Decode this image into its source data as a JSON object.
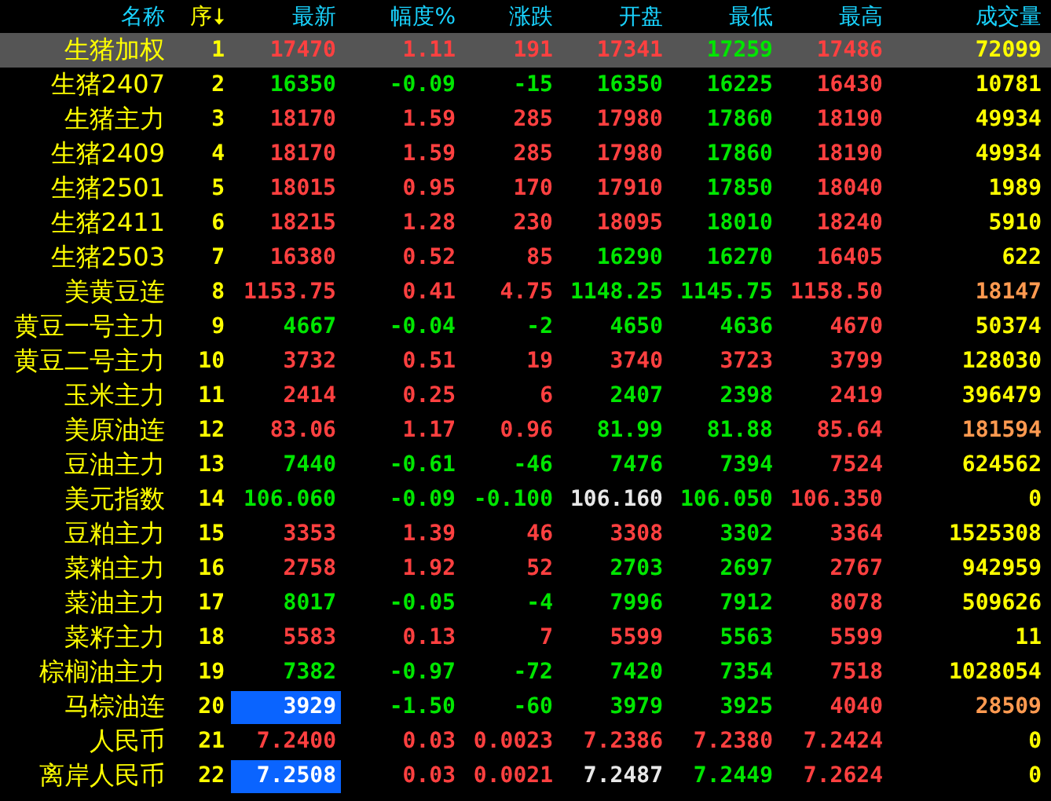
{
  "columns": [
    {
      "label": "名称",
      "sorted": false
    },
    {
      "label": "序",
      "sorted": true
    },
    {
      "label": "最新",
      "sorted": false
    },
    {
      "label": "幅度%",
      "sorted": false
    },
    {
      "label": "涨跌",
      "sorted": false
    },
    {
      "label": "开盘",
      "sorted": false
    },
    {
      "label": "最低",
      "sorted": false
    },
    {
      "label": "最高",
      "sorted": false
    },
    {
      "label": "成交量",
      "sorted": false
    }
  ],
  "rows": [
    {
      "name": "生猪加权",
      "seq": "1",
      "selected": true,
      "latest": {
        "text": "17470",
        "color": "#ff4040",
        "highlighted": false
      },
      "values": [
        {
          "text": "1.11",
          "color": "#ff4040"
        },
        {
          "text": "191",
          "color": "#ff4040"
        },
        {
          "text": "17341",
          "color": "#ff4040"
        },
        {
          "text": "17259",
          "color": "#00e600"
        },
        {
          "text": "17486",
          "color": "#ff4040"
        },
        {
          "text": "72099",
          "color": "#ffff00"
        }
      ]
    },
    {
      "name": "生猪2407",
      "seq": "2",
      "selected": false,
      "latest": {
        "text": "16350",
        "color": "#00e600",
        "highlighted": false
      },
      "values": [
        {
          "text": "-0.09",
          "color": "#00e600"
        },
        {
          "text": "-15",
          "color": "#00e600"
        },
        {
          "text": "16350",
          "color": "#00e600"
        },
        {
          "text": "16225",
          "color": "#00e600"
        },
        {
          "text": "16430",
          "color": "#ff4040"
        },
        {
          "text": "10781",
          "color": "#ffff00"
        }
      ]
    },
    {
      "name": "生猪主力",
      "seq": "3",
      "selected": false,
      "latest": {
        "text": "18170",
        "color": "#ff4040",
        "highlighted": false
      },
      "values": [
        {
          "text": "1.59",
          "color": "#ff4040"
        },
        {
          "text": "285",
          "color": "#ff4040"
        },
        {
          "text": "17980",
          "color": "#ff4040"
        },
        {
          "text": "17860",
          "color": "#00e600"
        },
        {
          "text": "18190",
          "color": "#ff4040"
        },
        {
          "text": "49934",
          "color": "#ffff00"
        }
      ]
    },
    {
      "name": "生猪2409",
      "seq": "4",
      "selected": false,
      "latest": {
        "text": "18170",
        "color": "#ff4040",
        "highlighted": false
      },
      "values": [
        {
          "text": "1.59",
          "color": "#ff4040"
        },
        {
          "text": "285",
          "color": "#ff4040"
        },
        {
          "text": "17980",
          "color": "#ff4040"
        },
        {
          "text": "17860",
          "color": "#00e600"
        },
        {
          "text": "18190",
          "color": "#ff4040"
        },
        {
          "text": "49934",
          "color": "#ffff00"
        }
      ]
    },
    {
      "name": "生猪2501",
      "seq": "5",
      "selected": false,
      "latest": {
        "text": "18015",
        "color": "#ff4040",
        "highlighted": false
      },
      "values": [
        {
          "text": "0.95",
          "color": "#ff4040"
        },
        {
          "text": "170",
          "color": "#ff4040"
        },
        {
          "text": "17910",
          "color": "#ff4040"
        },
        {
          "text": "17850",
          "color": "#00e600"
        },
        {
          "text": "18040",
          "color": "#ff4040"
        },
        {
          "text": "1989",
          "color": "#ffff00"
        }
      ]
    },
    {
      "name": "生猪2411",
      "seq": "6",
      "selected": false,
      "latest": {
        "text": "18215",
        "color": "#ff4040",
        "highlighted": false
      },
      "values": [
        {
          "text": "1.28",
          "color": "#ff4040"
        },
        {
          "text": "230",
          "color": "#ff4040"
        },
        {
          "text": "18095",
          "color": "#ff4040"
        },
        {
          "text": "18010",
          "color": "#00e600"
        },
        {
          "text": "18240",
          "color": "#ff4040"
        },
        {
          "text": "5910",
          "color": "#ffff00"
        }
      ]
    },
    {
      "name": "生猪2503",
      "seq": "7",
      "selected": false,
      "latest": {
        "text": "16380",
        "color": "#ff4040",
        "highlighted": false
      },
      "values": [
        {
          "text": "0.52",
          "color": "#ff4040"
        },
        {
          "text": "85",
          "color": "#ff4040"
        },
        {
          "text": "16290",
          "color": "#00e600"
        },
        {
          "text": "16270",
          "color": "#00e600"
        },
        {
          "text": "16405",
          "color": "#ff4040"
        },
        {
          "text": "622",
          "color": "#ffff00"
        }
      ]
    },
    {
      "name": "美黄豆连",
      "seq": "8",
      "selected": false,
      "latest": {
        "text": "1153.75",
        "color": "#ff4040",
        "highlighted": false
      },
      "values": [
        {
          "text": "0.41",
          "color": "#ff4040"
        },
        {
          "text": "4.75",
          "color": "#ff4040"
        },
        {
          "text": "1148.25",
          "color": "#00e600"
        },
        {
          "text": "1145.75",
          "color": "#00e600"
        },
        {
          "text": "1158.50",
          "color": "#ff4040"
        },
        {
          "text": "18147",
          "color": "#ff9a50"
        }
      ]
    },
    {
      "name": "黄豆一号主力",
      "seq": "9",
      "selected": false,
      "latest": {
        "text": "4667",
        "color": "#00e600",
        "highlighted": false
      },
      "values": [
        {
          "text": "-0.04",
          "color": "#00e600"
        },
        {
          "text": "-2",
          "color": "#00e600"
        },
        {
          "text": "4650",
          "color": "#00e600"
        },
        {
          "text": "4636",
          "color": "#00e600"
        },
        {
          "text": "4670",
          "color": "#ff4040"
        },
        {
          "text": "50374",
          "color": "#ffff00"
        }
      ]
    },
    {
      "name": "黄豆二号主力",
      "seq": "10",
      "selected": false,
      "latest": {
        "text": "3732",
        "color": "#ff4040",
        "highlighted": false
      },
      "values": [
        {
          "text": "0.51",
          "color": "#ff4040"
        },
        {
          "text": "19",
          "color": "#ff4040"
        },
        {
          "text": "3740",
          "color": "#ff4040"
        },
        {
          "text": "3723",
          "color": "#ff4040"
        },
        {
          "text": "3799",
          "color": "#ff4040"
        },
        {
          "text": "128030",
          "color": "#ffff00"
        }
      ]
    },
    {
      "name": "玉米主力",
      "seq": "11",
      "selected": false,
      "latest": {
        "text": "2414",
        "color": "#ff4040",
        "highlighted": false
      },
      "values": [
        {
          "text": "0.25",
          "color": "#ff4040"
        },
        {
          "text": "6",
          "color": "#ff4040"
        },
        {
          "text": "2407",
          "color": "#00e600"
        },
        {
          "text": "2398",
          "color": "#00e600"
        },
        {
          "text": "2419",
          "color": "#ff4040"
        },
        {
          "text": "396479",
          "color": "#ffff00"
        }
      ]
    },
    {
      "name": "美原油连",
      "seq": "12",
      "selected": false,
      "latest": {
        "text": "83.06",
        "color": "#ff4040",
        "highlighted": false
      },
      "values": [
        {
          "text": "1.17",
          "color": "#ff4040"
        },
        {
          "text": "0.96",
          "color": "#ff4040"
        },
        {
          "text": "81.99",
          "color": "#00e600"
        },
        {
          "text": "81.88",
          "color": "#00e600"
        },
        {
          "text": "85.64",
          "color": "#ff4040"
        },
        {
          "text": "181594",
          "color": "#ff9a50"
        }
      ]
    },
    {
      "name": "豆油主力",
      "seq": "13",
      "selected": false,
      "latest": {
        "text": "7440",
        "color": "#00e600",
        "highlighted": false
      },
      "values": [
        {
          "text": "-0.61",
          "color": "#00e600"
        },
        {
          "text": "-46",
          "color": "#00e600"
        },
        {
          "text": "7476",
          "color": "#00e600"
        },
        {
          "text": "7394",
          "color": "#00e600"
        },
        {
          "text": "7524",
          "color": "#ff4040"
        },
        {
          "text": "624562",
          "color": "#ffff00"
        }
      ]
    },
    {
      "name": "美元指数",
      "seq": "14",
      "selected": false,
      "latest": {
        "text": "106.060",
        "color": "#00e600",
        "highlighted": false
      },
      "values": [
        {
          "text": "-0.09",
          "color": "#00e600"
        },
        {
          "text": "-0.100",
          "color": "#00e600"
        },
        {
          "text": "106.160",
          "color": "#e8e8e8"
        },
        {
          "text": "106.050",
          "color": "#00e600"
        },
        {
          "text": "106.350",
          "color": "#ff4040"
        },
        {
          "text": "0",
          "color": "#ffff00"
        }
      ]
    },
    {
      "name": "豆粕主力",
      "seq": "15",
      "selected": false,
      "latest": {
        "text": "3353",
        "color": "#ff4040",
        "highlighted": false
      },
      "values": [
        {
          "text": "1.39",
          "color": "#ff4040"
        },
        {
          "text": "46",
          "color": "#ff4040"
        },
        {
          "text": "3308",
          "color": "#ff4040"
        },
        {
          "text": "3302",
          "color": "#00e600"
        },
        {
          "text": "3364",
          "color": "#ff4040"
        },
        {
          "text": "1525308",
          "color": "#ffff00"
        }
      ]
    },
    {
      "name": "菜粕主力",
      "seq": "16",
      "selected": false,
      "latest": {
        "text": "2758",
        "color": "#ff4040",
        "highlighted": false
      },
      "values": [
        {
          "text": "1.92",
          "color": "#ff4040"
        },
        {
          "text": "52",
          "color": "#ff4040"
        },
        {
          "text": "2703",
          "color": "#00e600"
        },
        {
          "text": "2697",
          "color": "#00e600"
        },
        {
          "text": "2767",
          "color": "#ff4040"
        },
        {
          "text": "942959",
          "color": "#ffff00"
        }
      ]
    },
    {
      "name": "菜油主力",
      "seq": "17",
      "selected": false,
      "latest": {
        "text": "8017",
        "color": "#00e600",
        "highlighted": false
      },
      "values": [
        {
          "text": "-0.05",
          "color": "#00e600"
        },
        {
          "text": "-4",
          "color": "#00e600"
        },
        {
          "text": "7996",
          "color": "#00e600"
        },
        {
          "text": "7912",
          "color": "#00e600"
        },
        {
          "text": "8078",
          "color": "#ff4040"
        },
        {
          "text": "509626",
          "color": "#ffff00"
        }
      ]
    },
    {
      "name": "菜籽主力",
      "seq": "18",
      "selected": false,
      "latest": {
        "text": "5583",
        "color": "#ff4040",
        "highlighted": false
      },
      "values": [
        {
          "text": "0.13",
          "color": "#ff4040"
        },
        {
          "text": "7",
          "color": "#ff4040"
        },
        {
          "text": "5599",
          "color": "#ff4040"
        },
        {
          "text": "5563",
          "color": "#00e600"
        },
        {
          "text": "5599",
          "color": "#ff4040"
        },
        {
          "text": "11",
          "color": "#ffff00"
        }
      ]
    },
    {
      "name": "棕榈油主力",
      "seq": "19",
      "selected": false,
      "latest": {
        "text": "7382",
        "color": "#00e600",
        "highlighted": false
      },
      "values": [
        {
          "text": "-0.97",
          "color": "#00e600"
        },
        {
          "text": "-72",
          "color": "#00e600"
        },
        {
          "text": "7420",
          "color": "#00e600"
        },
        {
          "text": "7354",
          "color": "#00e600"
        },
        {
          "text": "7518",
          "color": "#ff4040"
        },
        {
          "text": "1028054",
          "color": "#ffff00"
        }
      ]
    },
    {
      "name": "马棕油连",
      "seq": "20",
      "selected": false,
      "latest": {
        "text": "3929",
        "highlighted": true
      },
      "values": [
        {
          "text": "-1.50",
          "color": "#00e600"
        },
        {
          "text": "-60",
          "color": "#00e600"
        },
        {
          "text": "3979",
          "color": "#00e600"
        },
        {
          "text": "3925",
          "color": "#00e600"
        },
        {
          "text": "4040",
          "color": "#ff4040"
        },
        {
          "text": "28509",
          "color": "#ff9a50"
        }
      ]
    },
    {
      "name": "人民币",
      "seq": "21",
      "selected": false,
      "latest": {
        "text": "7.2400",
        "color": "#ff4040",
        "highlighted": false
      },
      "values": [
        {
          "text": "0.03",
          "color": "#ff4040"
        },
        {
          "text": "0.0023",
          "color": "#ff4040"
        },
        {
          "text": "7.2386",
          "color": "#ff4040"
        },
        {
          "text": "7.2380",
          "color": "#ff4040"
        },
        {
          "text": "7.2424",
          "color": "#ff4040"
        },
        {
          "text": "0",
          "color": "#ffff00"
        }
      ]
    },
    {
      "name": "离岸人民币",
      "seq": "22",
      "selected": false,
      "latest": {
        "text": "7.2508",
        "highlighted": true
      },
      "values": [
        {
          "text": "0.03",
          "color": "#ff4040"
        },
        {
          "text": "0.0021",
          "color": "#ff4040"
        },
        {
          "text": "7.2487",
          "color": "#e8e8e8"
        },
        {
          "text": "7.2449",
          "color": "#00e600"
        },
        {
          "text": "7.2624",
          "color": "#ff4040"
        },
        {
          "text": "0",
          "color": "#ffff00"
        }
      ]
    }
  ]
}
